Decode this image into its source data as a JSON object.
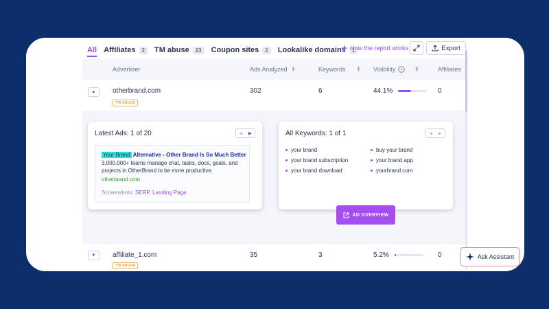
{
  "tabs": [
    {
      "label": "All",
      "count": ""
    },
    {
      "label": "Affiliates",
      "count": "2"
    },
    {
      "label": "TM abuse",
      "count": "23"
    },
    {
      "label": "Coupon sites",
      "count": "2"
    },
    {
      "label": "Lookalike domains",
      "count": "1"
    }
  ],
  "toolbar": {
    "how_label": "How the report works",
    "export_label": "Export"
  },
  "columns": {
    "advertiser": "Advertiser",
    "ads_analyzed": "Ads Analyzed",
    "keywords": "Keywords",
    "visibility": "Visibility",
    "affiliates": "Affiliates"
  },
  "rows": [
    {
      "advertiser": "otherbrand.com",
      "badge": "TM ABUSE",
      "ads": "302",
      "keywords": "6",
      "visibility": "44.1%",
      "visibility_fraction": 0.441,
      "affiliates": "0"
    },
    {
      "advertiser": "affiliate_1.com",
      "badge": "TM ABUSE",
      "ads": "35",
      "keywords": "3",
      "visibility": "5.2%",
      "visibility_fraction": 0.052,
      "affiliates": "0"
    }
  ],
  "latest_ads": {
    "title": "Latest Ads: 1 of 20",
    "headline_highlight": "Your Brand",
    "headline_rest": "Alternative - Other Brand Is So Much Better",
    "description": "3,000,000+ teams manage chat, tasks, docs, goals, and projects in OtherBrand to be more productive.",
    "display_url": "otherbrand.com",
    "screenshots_label": "Screenshots:",
    "screenshot_links": [
      "SERP",
      "Landing Page"
    ]
  },
  "all_keywords": {
    "title": "All Keywords: 1 of 1",
    "items": [
      "your brand",
      "buy your brand",
      "your brand subscription",
      "your brand app",
      "your brand download",
      "yourbrand.com"
    ]
  },
  "ad_overview_label": "AD OVERVIEW",
  "assistant_label": "Ask Assistant",
  "colors": {
    "background": "#0a2f6b",
    "accent": "#9b4dea",
    "highlight": "#2ee6c6",
    "badge": "#e0862a"
  }
}
